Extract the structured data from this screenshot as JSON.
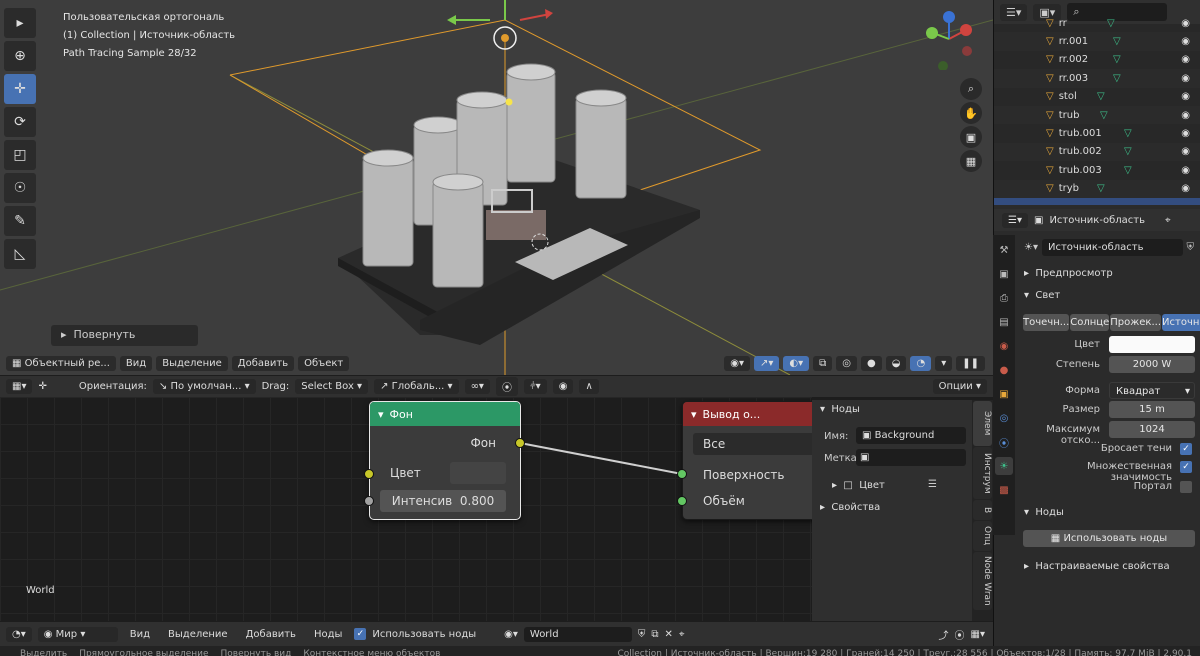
{
  "viewport": {
    "view_name": "Пользовательская ортогональ",
    "collection_line": "(1) Collection | Источник-область",
    "sample_line": "Path Tracing Sample 28/32",
    "redo_panel": "Повернуть",
    "header": {
      "mode": "Объектный ре...",
      "menu": [
        "Вид",
        "Выделение",
        "Добавить",
        "Объект"
      ]
    },
    "toolbar_icons": [
      "select-cursor-icon",
      "cursor-icon",
      "move-icon",
      "rotate-icon",
      "scale-icon",
      "transform-icon",
      "annotate-icon",
      "measure-icon"
    ]
  },
  "tool_header": {
    "orientation_label": "Ориентация:",
    "orientation_value": "По умолчан...",
    "drag_label": "Drag:",
    "drag_value": "Select Box",
    "pivot_value": "Глобаль...",
    "options_label": "Опции"
  },
  "node_editor": {
    "world_label": "World",
    "background_node": {
      "title": "Фон",
      "output": "Фон",
      "color_label": "Цвет",
      "strength_label": "Интенсив",
      "strength_value": "0.800"
    },
    "output_node": {
      "title": "Вывод о...",
      "target": "Все",
      "surface": "Поверхность",
      "volume": "Объём"
    },
    "colors": {
      "background_head": "#2c9866",
      "output_head": "#8b2a2a",
      "socket_yellow": "#c7c729",
      "socket_green": "#63c763",
      "socket_grey": "#a1a1a1"
    }
  },
  "npanel": {
    "nodes_section": "Ноды",
    "name_label": "Имя:",
    "name_value": "Background",
    "label_label": "Метка:",
    "color_row": "Цвет",
    "properties_section": "Свойства",
    "tabs": [
      "Элем",
      "Инструм",
      "В",
      "Опц",
      "Node Wran"
    ]
  },
  "ne_header": {
    "world_dropdown": "Мир",
    "menu": [
      "Вид",
      "Выделение",
      "Добавить",
      "Ноды"
    ],
    "use_nodes": "Использовать ноды",
    "world_name": "World"
  },
  "statusbar": [
    "Выделить",
    "Прямоугольное выделение",
    "Повернуть вид",
    "Контекстное меню объектов",
    "Collection | Источник-область | Вершин:19 280 | Граней:14 250 | Треуг.:28 556 | Объектов:1/28 | Память: 97.7 MiB | 2.90.1"
  ],
  "outliner": {
    "items": [
      {
        "name": "rr",
        "mesh": true
      },
      {
        "name": "rr.001",
        "mesh": true
      },
      {
        "name": "rr.002",
        "mesh": true
      },
      {
        "name": "rr.003",
        "mesh": true
      },
      {
        "name": "stol",
        "mesh": true
      },
      {
        "name": "trub",
        "mesh": true
      },
      {
        "name": "trub.001",
        "mesh": true
      },
      {
        "name": "trub.002",
        "mesh": true
      },
      {
        "name": "trub.003",
        "mesh": true
      },
      {
        "name": "tryb",
        "mesh": true
      }
    ]
  },
  "properties": {
    "header_object": "Источник-область",
    "light_name": "Источник-область",
    "preview_section": "Предпросмотр",
    "light_section": "Свет",
    "light_types": [
      "Точечн...",
      "Солнце",
      "Прожек...",
      "Источн..."
    ],
    "active_type_index": 3,
    "color_label": "Цвет",
    "power_label": "Степень",
    "power_value": "2000 W",
    "shape_label": "Форма",
    "shape_value": "Квадрат",
    "size_label": "Размер",
    "size_value": "15 m",
    "max_bounces_label": "Максимум отско...",
    "max_bounces_value": "1024",
    "cast_shadow": "Бросает тени",
    "multiple_importance": "Множественная значимость",
    "portal": "Портал",
    "nodes_section": "Ноды",
    "use_nodes_button": "Использовать ноды",
    "custom_props": "Настраиваемые свойства"
  }
}
